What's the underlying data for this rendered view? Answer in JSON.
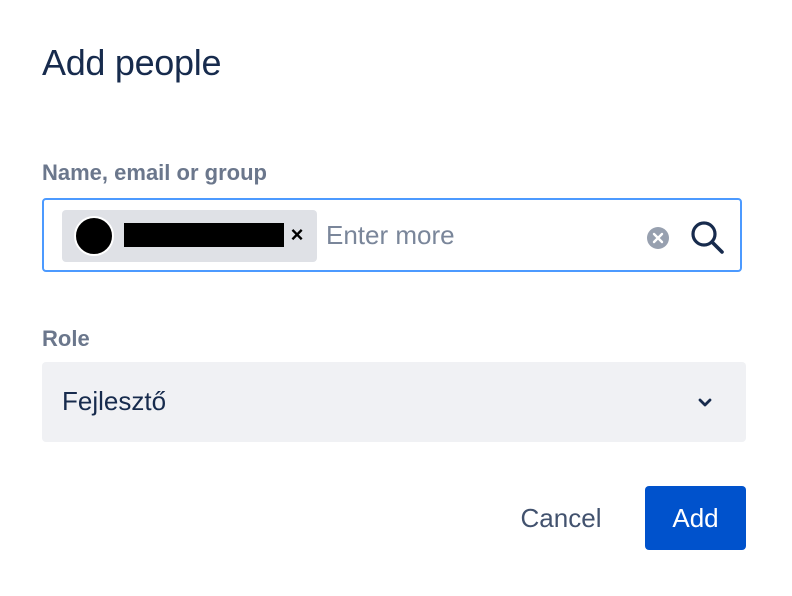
{
  "dialog": {
    "title": "Add people"
  },
  "people_field": {
    "label": "Name, email or group",
    "placeholder": "Enter more",
    "selected": [
      {
        "name": "",
        "remove_label": "×",
        "redacted": true
      }
    ],
    "clear_icon": "clear-circle-icon",
    "search_icon": "search-icon"
  },
  "role_field": {
    "label": "Role",
    "value": "Fejlesztő",
    "dropdown_icon": "chevron-down-icon"
  },
  "actions": {
    "cancel_label": "Cancel",
    "add_label": "Add"
  },
  "colors": {
    "focus_border": "#4c9aff",
    "primary": "#0052cc",
    "text": "#172b4d",
    "label": "#6b778c",
    "chip_bg": "#dfe1e6",
    "select_bg": "#f0f1f4"
  }
}
